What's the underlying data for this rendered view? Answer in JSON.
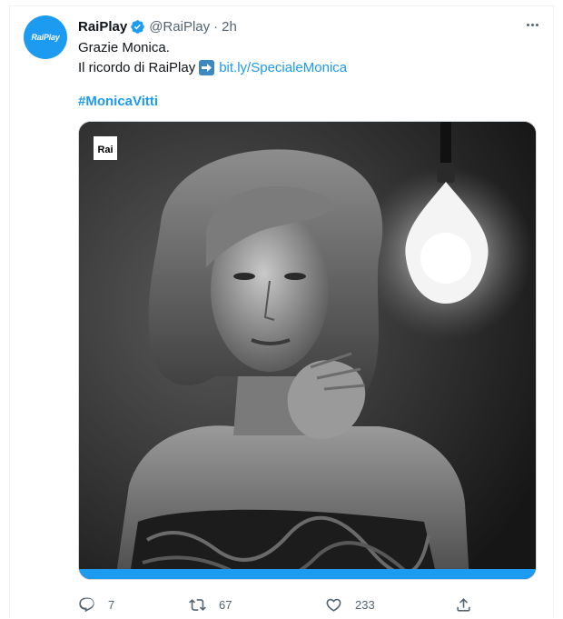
{
  "tweet": {
    "display_name": "RaiPlay",
    "handle": "@RaiPlay",
    "separator": "·",
    "time": "2h",
    "avatar_text": "RaiPlay",
    "line1": "Grazie Monica.",
    "line2_prefix": "Il ricordo di RaiPlay",
    "link": "bit.ly/SpecialeMonica",
    "hashtag": "#MonicaVitti"
  },
  "media": {
    "watermark": "Rai",
    "description_icon": "photo-of-woman-with-light-bulb"
  },
  "actions": {
    "replies": "7",
    "retweets": "67",
    "likes": "233"
  },
  "colors": {
    "brand_blue": "#1d9bf0",
    "text_primary": "#0f1419",
    "text_secondary": "#536471"
  }
}
